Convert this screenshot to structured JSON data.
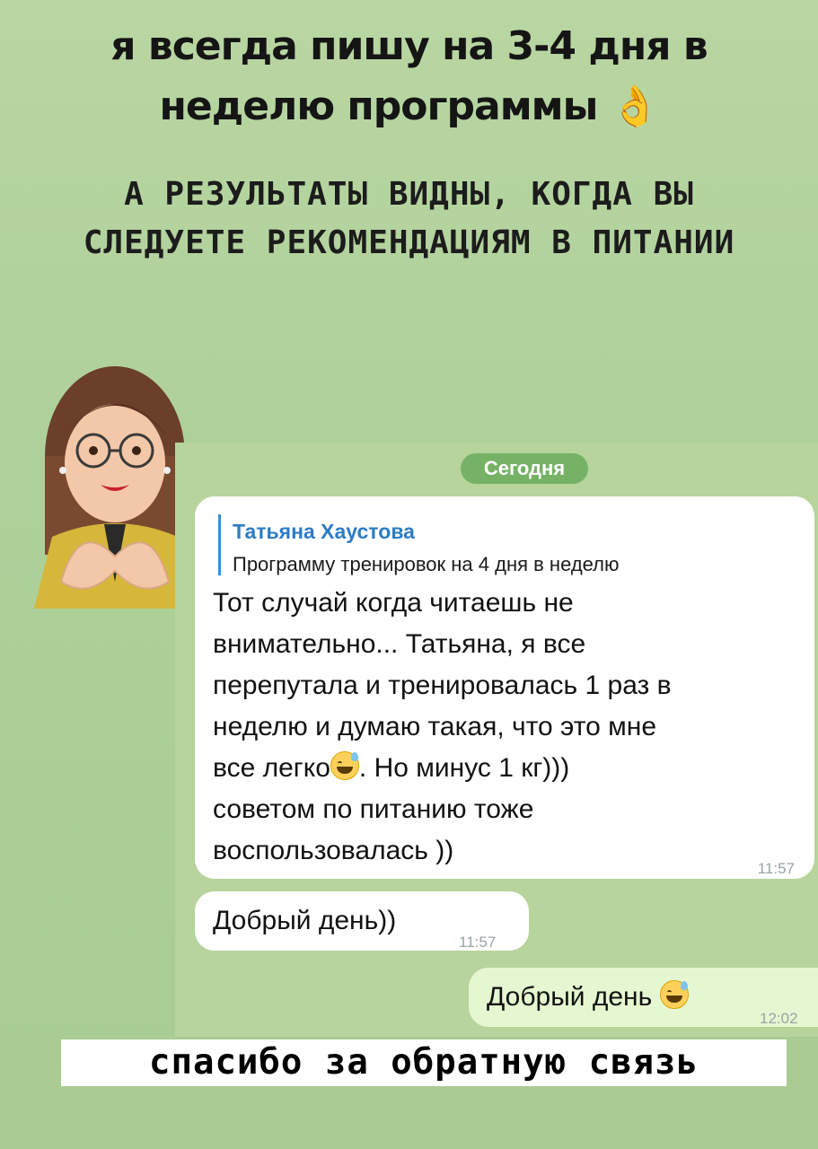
{
  "header": {
    "line1": "я всегда пишу на 3-4 дня в",
    "line2": "неделю программы 👌",
    "sub1": "А РЕЗУЛЬТАТЫ ВИДНЫ, КОГДА ВЫ",
    "sub2": "СЛЕДУЕТЕ РЕКОМЕНДАЦИЯМ В ПИТАНИИ"
  },
  "chat": {
    "date_label": "Сегодня",
    "reply": {
      "name": "Татьяна Хаустова",
      "text": "Программу тренировок на 4 дня в неделю"
    },
    "message1": {
      "lines": [
        "Тот случай когда читаешь не",
        "внимательно... Татьяна, я все",
        "перепутала и тренировалась 1 раз в",
        "неделю и думаю такая, что это мне",
        "все легко",
        ". Но минус 1 кг)))",
        "советом  по питанию тоже",
        "воспользовалась ))"
      ],
      "time": "11:57"
    },
    "message2": {
      "text": "Добрый день))",
      "time": "11:57"
    },
    "message3": {
      "text": "Добрый день",
      "time": "12:02"
    }
  },
  "footer": {
    "thanks": "спасибо за обратную связь"
  },
  "colors": {
    "background": "#aed09a",
    "date_pill": "#76b265",
    "reply_name": "#2d7cc5",
    "outgoing": "#e5f7d0"
  }
}
